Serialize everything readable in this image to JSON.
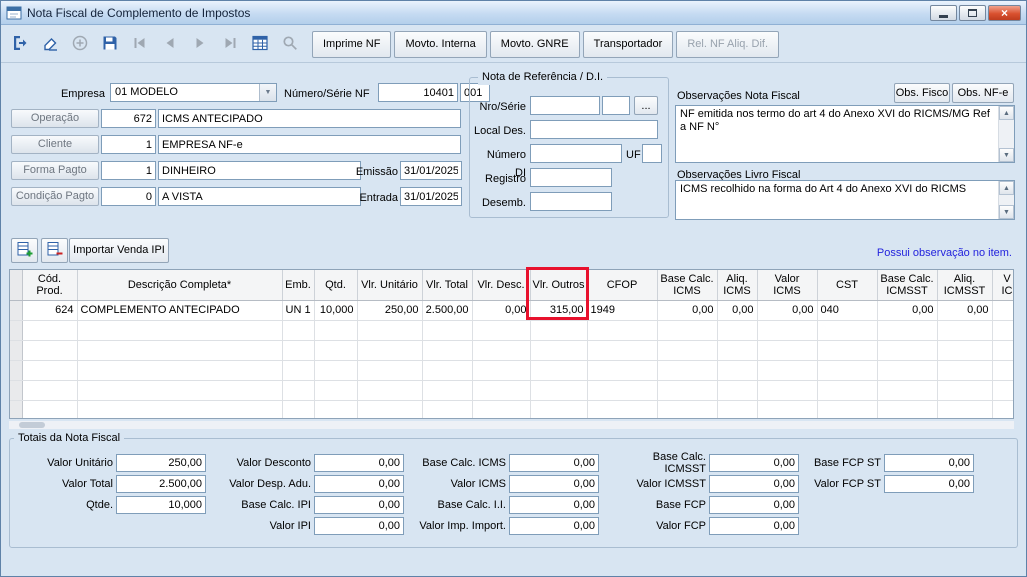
{
  "window": {
    "title": "Nota Fiscal de Complemento de Impostos"
  },
  "toolbar": {
    "icon_buttons": [
      {
        "name": "exit",
        "enabled": true
      },
      {
        "name": "clear",
        "enabled": true
      },
      {
        "name": "add",
        "enabled": false
      },
      {
        "name": "save",
        "enabled": true
      },
      {
        "name": "nav-first",
        "enabled": false
      },
      {
        "name": "nav-prev",
        "enabled": false
      },
      {
        "name": "nav-next",
        "enabled": false
      },
      {
        "name": "nav-last",
        "enabled": false
      },
      {
        "name": "grid",
        "enabled": true
      },
      {
        "name": "search",
        "enabled": false
      }
    ],
    "text_buttons": [
      {
        "label": "Imprime NF",
        "enabled": true
      },
      {
        "label": "Movto. Interna",
        "enabled": true
      },
      {
        "label": "Movto. GNRE",
        "enabled": true
      },
      {
        "label": "Transportador",
        "enabled": true
      },
      {
        "label": "Rel. NF Aliq. Dif.",
        "enabled": false
      }
    ]
  },
  "form": {
    "empresa_label": "Empresa",
    "empresa_value": "01 MODELO",
    "numero_serie_label": "Número/Série NF",
    "numero_nf": "10401",
    "serie_nf": "001",
    "operacao_label": "Operação",
    "operacao_code": "672",
    "operacao_desc": "ICMS ANTECIPADO",
    "cliente_label": "Cliente",
    "cliente_code": "1",
    "cliente_desc": "EMPRESA NF-e",
    "forma_pagto_label": "Forma Pagto",
    "forma_pagto_code": "1",
    "forma_pagto_desc": "DINHEIRO",
    "emissao_label": "Emissão",
    "emissao_value": "31/01/2025",
    "condicao_pagto_label": "Condição Pagto",
    "condicao_pagto_code": "0",
    "condicao_pagto_desc": "A VISTA",
    "entrada_label": "Entrada",
    "entrada_value": "31/01/2025"
  },
  "referencia": {
    "title": "Nota de Referência / D.I.",
    "nro_serie_label": "Nro/Série",
    "nro_serie_value": "",
    "nro_serie_value2": "",
    "browse_button": "...",
    "local_des_label": "Local Des.",
    "local_des_value": "",
    "numero_di_label": "Número DI",
    "numero_di_value": "",
    "uf_label": "UF",
    "uf_value": "",
    "registro_label": "Registro",
    "registro_value": "",
    "desemb_label": "Desemb.",
    "desemb_value": ""
  },
  "observacoes": {
    "nota_fiscal_label": "Observações Nota Fiscal",
    "obs_fisco_button": "Obs. Fisco",
    "obs_nfe_button": "Obs. NF-e",
    "nota_fiscal_text": "NF emitida nos termo do art 4 do Anexo XVI do RICMS/MG Ref a NF N°",
    "livro_fiscal_label": "Observações Livro Fiscal",
    "livro_fiscal_text": "ICMS recolhido na forma do Art 4 do Anexo XVI do RICMS"
  },
  "items_bar": {
    "icon_buttons": [
      {
        "name": "item-add"
      },
      {
        "name": "item-remove"
      }
    ],
    "importar_venda_ipi_button": "Importar Venda IPI",
    "possui_observacao_text": "Possui observação no item.",
    "possui_observacao_color": "#2323dd"
  },
  "table": {
    "headers": [
      [
        "Cód.",
        "Prod."
      ],
      [
        "Descrição Completa*"
      ],
      [
        "Emb."
      ],
      [
        "Qtd."
      ],
      [
        "Vlr. Unitário"
      ],
      [
        "Vlr. Total"
      ],
      [
        "Vlr. Desc."
      ],
      [
        "Vlr. Outros"
      ],
      [
        "CFOP"
      ],
      [
        "Base Calc.",
        "ICMS"
      ],
      [
        "Aliq.",
        "ICMS"
      ],
      [
        "Valor ICMS"
      ],
      [
        "CST"
      ],
      [
        "Base Calc.",
        "ICMSST"
      ],
      [
        "Aliq.",
        "ICMSST"
      ],
      [
        "V",
        "IC"
      ]
    ],
    "rows": [
      [
        "624",
        "COMPLEMENTO ANTECIPADO",
        "UN 1",
        "10,000",
        "250,00",
        "2.500,00",
        "0,00",
        "315,00",
        "1949",
        "0,00",
        "0,00",
        "0,00",
        "040",
        "0,00",
        "0,00",
        ""
      ]
    ]
  },
  "highlight": {
    "target": "Vlr. Outros",
    "color": "#e8112d"
  },
  "totais": {
    "title": "Totais da Nota Fiscal",
    "columns": [
      [
        {
          "label": "Valor Unitário",
          "value": "250,00"
        },
        {
          "label": "Valor Total",
          "value": "2.500,00"
        },
        {
          "label": "Qtde.",
          "value": "10,000"
        }
      ],
      [
        {
          "label": "Valor Desconto",
          "value": "0,00"
        },
        {
          "label": "Valor Desp. Adu.",
          "value": "0,00"
        },
        {
          "label": "Base Calc. IPI",
          "value": "0,00"
        },
        {
          "label": "Valor IPI",
          "value": "0,00"
        }
      ],
      [
        {
          "label": "Base Calc. ICMS",
          "value": "0,00"
        },
        {
          "label": "Valor ICMS",
          "value": "0,00"
        },
        {
          "label": "Base Calc. I.I.",
          "value": "0,00"
        },
        {
          "label": "Valor Imp. Import.",
          "value": "0,00"
        }
      ],
      [
        {
          "label": "Base Calc. ICMSST",
          "value": "0,00"
        },
        {
          "label": "Valor ICMSST",
          "value": "0,00"
        },
        {
          "label": "Base FCP",
          "value": "0,00"
        },
        {
          "label": "Valor FCP",
          "value": "0,00"
        }
      ],
      [
        {
          "label": "Base FCP ST",
          "value": "0,00"
        },
        {
          "label": "Valor FCP ST",
          "value": "0,00"
        }
      ]
    ]
  }
}
